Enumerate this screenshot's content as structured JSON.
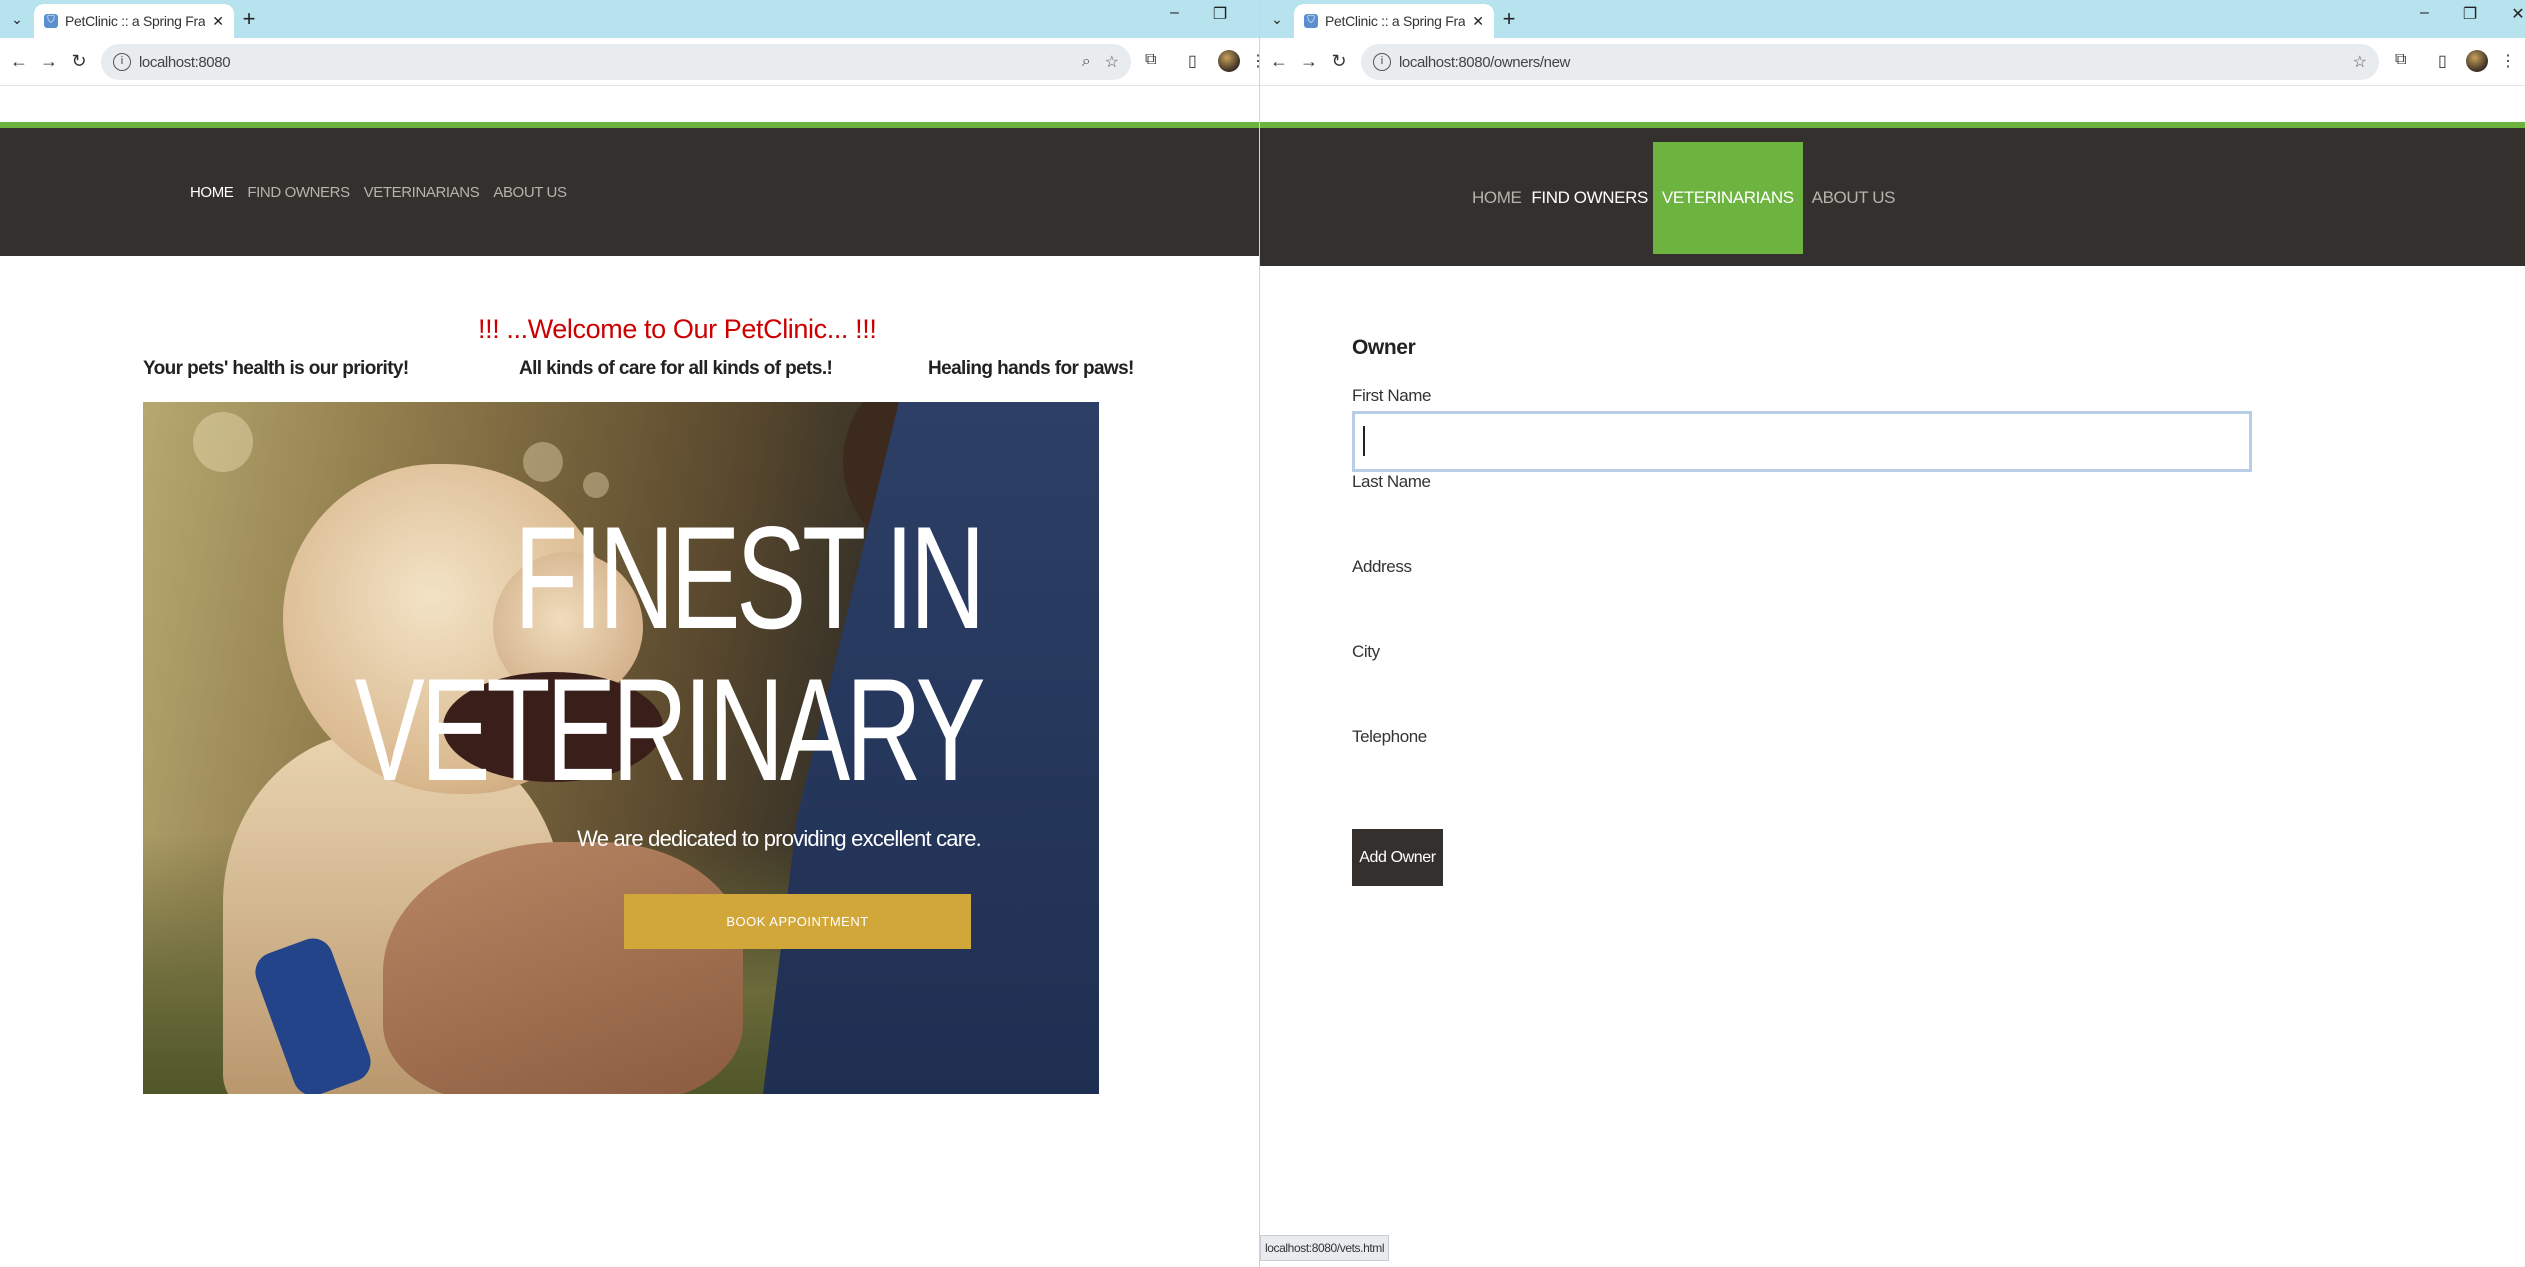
{
  "left": {
    "tab": {
      "title": "PetClinic :: a Spring Framework"
    },
    "url": "localhost:8080",
    "nav": [
      "HOME",
      "FIND OWNERS",
      "VETERINARIANS",
      "ABOUT US"
    ],
    "welcome": "!!! ...Welcome to Our PetClinic... !!!",
    "taglines": [
      "Your pets' health is our priority!",
      "All kinds of care for all kinds of pets.!",
      "Healing hands for paws!"
    ],
    "hero": {
      "title_line1": "FINEST IN",
      "title_line2": "VETERINARY",
      "subtitle": "We are dedicated to providing excellent care.",
      "button": "BOOK APPOINTMENT"
    }
  },
  "right": {
    "tab": {
      "title": "PetClinic :: a Spring Framework"
    },
    "url": "localhost:8080/owners/new",
    "nav": [
      "HOME",
      "FIND OWNERS",
      "VETERINARIANS",
      "ABOUT US"
    ],
    "form": {
      "heading": "Owner",
      "fields": [
        "First Name",
        "Last Name",
        "Address",
        "City",
        "Telephone"
      ],
      "first_name_value": "",
      "submit": "Add Owner"
    },
    "status_url": "localhost:8080/vets.html"
  },
  "icons": {
    "tab_search": "chevron-down-icon",
    "new_tab": "plus-icon",
    "back": "arrow-left-icon",
    "forward": "arrow-right-icon",
    "reload": "reload-icon",
    "site_info": "info-icon",
    "zoom": "magnifier-icon",
    "bookmark": "star-icon",
    "extensions": "puzzle-icon",
    "sidebar": "sidebar-icon",
    "menu": "kebab-icon"
  },
  "colors": {
    "tab_strip": "#b7e3ef",
    "navbar": "#34302d",
    "accent_green": "#6db33f",
    "welcome_red": "#cc0000",
    "hero_button": "#d2a73a"
  }
}
